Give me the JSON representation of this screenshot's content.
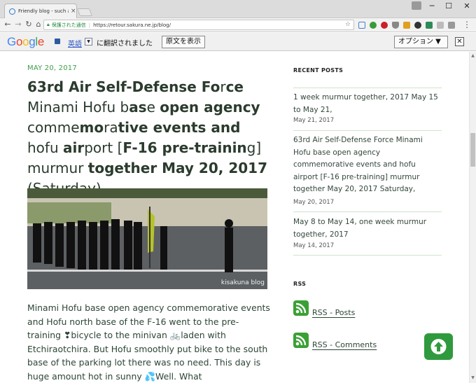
{
  "browser": {
    "tab_title": "Friendly blog - such as s...",
    "tab_close": "×",
    "secure_label": "保護された通信",
    "separator": "|",
    "url": "https://retour.sakura.ne.jp/blog/",
    "bookmark_glyph": "☆",
    "window_minimize": "─",
    "window_maximize": "☐",
    "window_close": "✕"
  },
  "translate_bar": {
    "logo": {
      "G": "G",
      "o1": "o",
      "o2": "o",
      "g": "g",
      "l": "l",
      "e": "e"
    },
    "language": "英語",
    "language_dropdown": "▼",
    "message": "に翻訳されました",
    "show_original_label": "原文を表示",
    "options_label": "オプション ▼",
    "close_label": "✕"
  },
  "post": {
    "date": "MAY 20, 2017",
    "title_parts": [
      {
        "text": "63rd ",
        "bold": true
      },
      {
        "text": "Air ",
        "bold": true
      },
      {
        "text": "Self-Defense Fo",
        "bold": true
      },
      {
        "text": "r",
        "bold": false
      },
      {
        "text": "ce ",
        "bold": true
      },
      {
        "text": "Minami Hofu b",
        "bold": false
      },
      {
        "text": "as",
        "bold": true
      },
      {
        "text": "e ",
        "bold": false
      },
      {
        "text": "open agency ",
        "bold": true
      },
      {
        "text": "comme",
        "bold": false
      },
      {
        "text": "mo",
        "bold": true
      },
      {
        "text": "ra",
        "bold": false
      },
      {
        "text": "tive events ",
        "bold": true
      },
      {
        "text": "and ",
        "bold": true
      },
      {
        "text": "hofu ",
        "bold": false
      },
      {
        "text": "air",
        "bold": true
      },
      {
        "text": "port [",
        "bold": false
      },
      {
        "text": "F-16 pre-trainin",
        "bold": true
      },
      {
        "text": "g] murmur ",
        "bold": false
      },
      {
        "text": "together May 20, 2017 ",
        "bold": true
      },
      {
        "text": "(Saturday)",
        "bold": false
      }
    ],
    "photo_watermark": "kisakuna blog",
    "body": "Minami Hofu base open agency commemorative events and Hofu north base of the F-16 went to the pre-training ❣bicycle to the minivan 🚲laden with Etchiraotchira. But Hofu smoothly put bike to the south base of the parking lot there was no need. This day is huge amount hot in sunny 💦Well. What"
  },
  "sidebar": {
    "recent_heading": "RECENT POSTS",
    "recent_posts": [
      {
        "title": "1 week murmur together, 2017 May 15 to May 21,",
        "date": "May 21, 2017"
      },
      {
        "title": "63rd Air Self-Defense Force Minami Hofu base open agency commemorative events and hofu airport [F-16 pre-training] murmur together May 20, 2017 Saturday,",
        "date": "May 20, 2017"
      },
      {
        "title": "May 8 to May 14, one week murmur together, 2017",
        "date": "May 14, 2017"
      }
    ],
    "rss_heading": "RSS",
    "rss_links": [
      "RSS - Posts",
      "RSS - Comments"
    ]
  },
  "colors": {
    "accent_green": "#3f9e4b",
    "back_to_top": "#2f9a3d",
    "body_text": "#2d4535"
  }
}
